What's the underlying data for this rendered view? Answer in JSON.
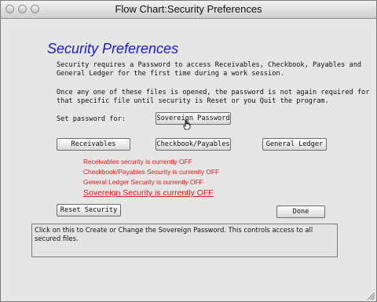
{
  "window": {
    "title": "Flow Chart:Security Preferences"
  },
  "page": {
    "heading": "Security Preferences",
    "paragraph1": [
      "Security requires a Password to access Receivables, Checkbook, Payables and",
      "General Ledger for the first time during a work session."
    ],
    "paragraph2": [
      "Once any one of these files is opened, the password is not again required for",
      "that specific file until security is Reset or you Quit the program."
    ],
    "set_password_label": "Set password for:"
  },
  "buttons": {
    "sovereign_password": "Sovereign Password",
    "receivables": "Receivables",
    "checkbook_payables": "Checkbook/Payables",
    "general_ledger": "General Ledger",
    "reset_security": "Reset Security",
    "done": "Done"
  },
  "status": {
    "receivables": "Receivables security is currently OFF",
    "checkbook": "Checkbook/Payables Security is currently OFF",
    "general_ledger": "General Ledger Security is currently OFF",
    "sovereign": "Sovereign Security is currently OFF"
  },
  "help_text": "Click on this to Create or Change the Sovereign Password. This controls access to all secured files.",
  "icons": {
    "close": "close-icon",
    "minimize": "minimize-icon",
    "zoom": "zoom-icon",
    "cursor": "hand-cursor-icon",
    "resize": "resize-grip-icon"
  },
  "colors": {
    "heading": "#1a1ad6",
    "status_text": "#e01b1b"
  }
}
